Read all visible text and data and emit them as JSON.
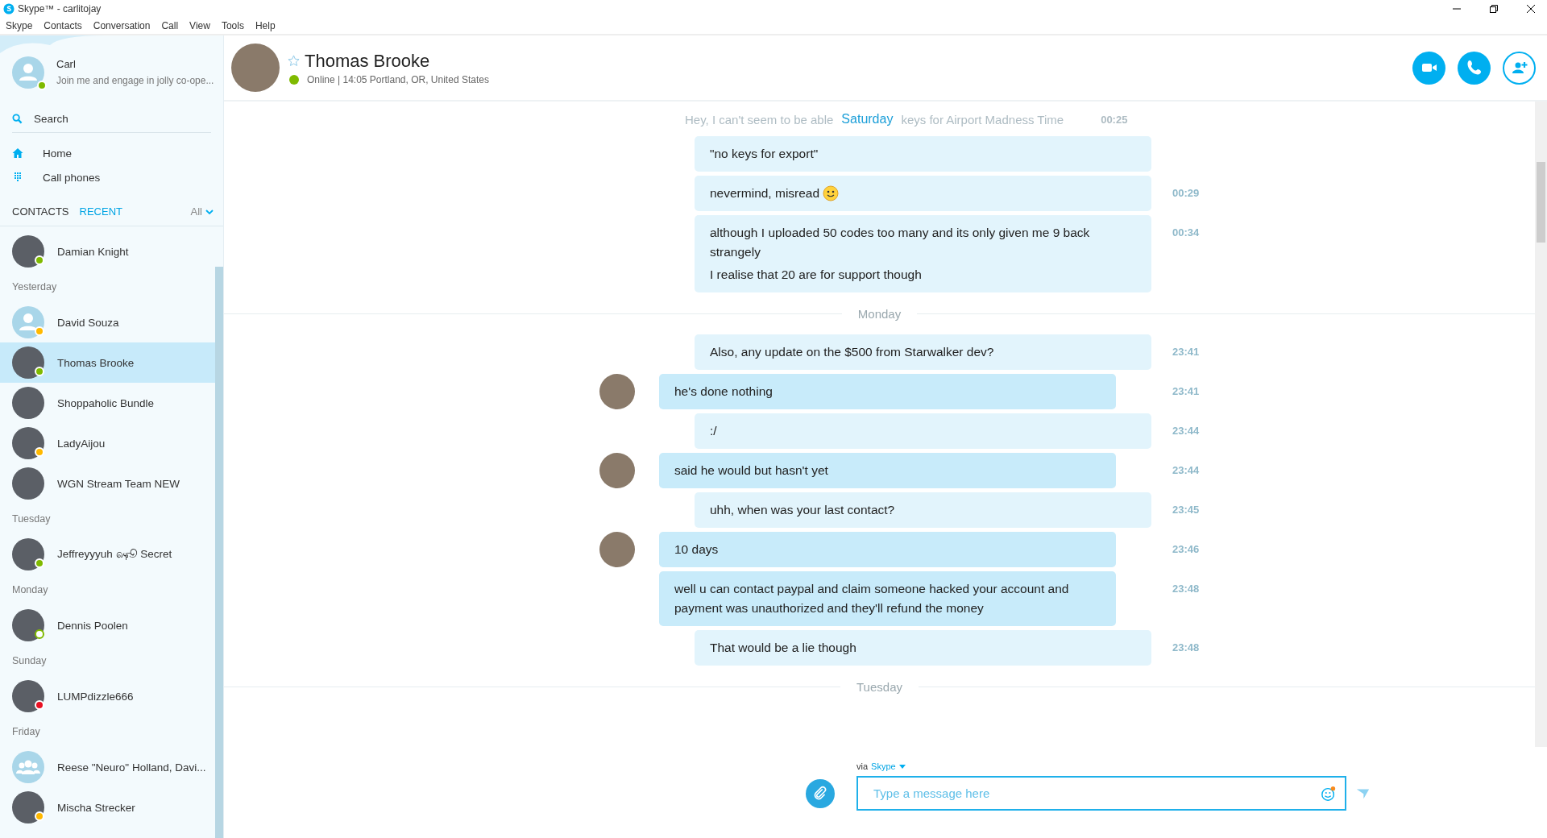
{
  "window": {
    "title": "Skype™ - carlitojay"
  },
  "menu": [
    "Skype",
    "Contacts",
    "Conversation",
    "Call",
    "View",
    "Tools",
    "Help"
  ],
  "profile": {
    "name": "Carl",
    "mood": "Join me and engage in jolly co-ope...",
    "color": "#7fba00"
  },
  "search": {
    "placeholder": "Search"
  },
  "nav": [
    {
      "label": "Home",
      "kind": "home"
    },
    {
      "label": "Call phones",
      "kind": "dialpad"
    }
  ],
  "list_tabs": [
    {
      "label": "CONTACTS",
      "selected": false
    },
    {
      "label": "RECENT",
      "selected": true
    }
  ],
  "filter": "All",
  "contact_groups": [
    {
      "items": [
        {
          "name": "Damian Knight",
          "kind": "photo",
          "color": "#7fba00",
          "hollow": false,
          "selected": false
        }
      ]
    },
    {
      "heading": "Yesterday",
      "items": [
        {
          "name": "David Souza",
          "kind": "default",
          "color": "#ffb900",
          "hollow": false,
          "selected": false
        },
        {
          "name": "Thomas Brooke",
          "kind": "photo",
          "color": "#7fba00",
          "hollow": false,
          "selected": true
        },
        {
          "name": "Shoppaholic Bundle",
          "kind": "photo",
          "selected": false
        },
        {
          "name": "LadyAijou",
          "kind": "photo",
          "color": "#ffb900",
          "hollow": false,
          "selected": false
        },
        {
          "name": "WGN Stream Team NEW",
          "kind": "photo",
          "selected": false
        }
      ]
    },
    {
      "heading": "Tuesday",
      "items": [
        {
          "name": "Jeffreyyyuh ஷூ Secret",
          "kind": "photo",
          "color": "#7fba00",
          "hollow": false,
          "selected": false
        }
      ]
    },
    {
      "heading": "Monday",
      "items": [
        {
          "name": "Dennis Poolen",
          "kind": "photo",
          "color": "#7fba00",
          "hollow": true,
          "selected": false
        }
      ]
    },
    {
      "heading": "Sunday",
      "items": [
        {
          "name": "LUMPdizzle666",
          "kind": "photo",
          "color": "#e81123",
          "hollow": false,
          "selected": false
        }
      ]
    },
    {
      "heading": "Friday",
      "items": [
        {
          "name": "Reese \"Neuro\" Holland, Davi...",
          "kind": "group",
          "selected": false
        },
        {
          "name": "Mischa Strecker",
          "kind": "photo",
          "color": "#ffb900",
          "hollow": false,
          "selected": false
        }
      ]
    }
  ],
  "conversation": {
    "name": "Thomas Brooke",
    "color": "#7fba00",
    "status_line": "Online | 14:05 Portland, OR, United States",
    "favorite": false
  },
  "faded": {
    "before": "Hey, I can't seem to be able",
    "sticky_day": "Saturday",
    "after": "keys for Airport Madness Time",
    "time": "00:25"
  },
  "messages": [
    {
      "kind": "out",
      "lines": [
        "\"no keys for export\""
      ],
      "emoji": false
    },
    {
      "kind": "out",
      "lines": [
        "nevermind, misread"
      ],
      "time": "00:29",
      "emoji": true
    },
    {
      "kind": "out",
      "lines": [
        "although I uploaded 50 codes too many and its only given me 9 back strangely",
        "I realise that 20 are for support though"
      ],
      "time": "00:34",
      "emoji": false
    },
    {
      "kind": "day",
      "lines": [
        "Monday"
      ]
    },
    {
      "kind": "out",
      "lines": [
        "Also, any update on the $500 from Starwalker dev?"
      ],
      "time": "23:41",
      "emoji": false
    },
    {
      "kind": "in",
      "lines": [
        "he's done nothing"
      ],
      "time": "23:41",
      "emoji": false
    },
    {
      "kind": "out",
      "lines": [
        ":/"
      ],
      "time": "23:44",
      "emoji": false
    },
    {
      "kind": "in",
      "lines": [
        "said he would but hasn't yet"
      ],
      "time": "23:44",
      "emoji": false
    },
    {
      "kind": "out",
      "lines": [
        "uhh, when was your last contact?"
      ],
      "time": "23:45",
      "emoji": false
    },
    {
      "kind": "in",
      "lines": [
        "10 days"
      ],
      "time": "23:46",
      "emoji": false
    },
    {
      "kind": "in",
      "lines": [
        "well u can contact paypal and claim someone hacked your account and payment was unauthorized and they'll refund the money"
      ],
      "time": "23:48",
      "emoji": false
    },
    {
      "kind": "out",
      "lines": [
        "That would be a lie though"
      ],
      "time": "23:48",
      "emoji": false
    },
    {
      "kind": "day",
      "lines": [
        "Tuesday"
      ]
    }
  ],
  "compose": {
    "via": "via",
    "service": "Skype",
    "placeholder": "Type a message here"
  }
}
